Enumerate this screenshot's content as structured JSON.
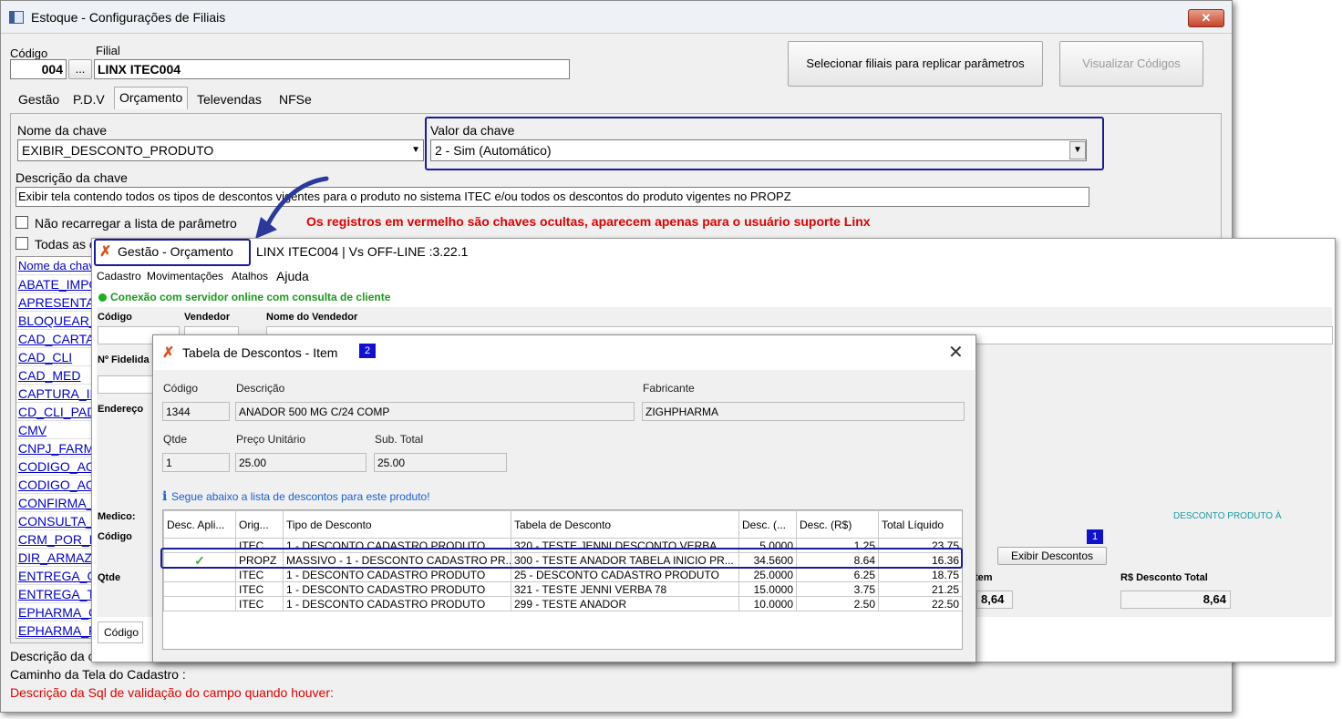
{
  "window": {
    "title": "Estoque - Configurações de Filiais",
    "close": "✕"
  },
  "header": {
    "codigo_label": "Código",
    "codigo_value": "004",
    "dots": "...",
    "filial_label": "Filial",
    "filial_value": "LINX ITEC004",
    "replicar_button": "Selecionar filiais para replicar parâmetros",
    "visualizar_button": "Visualizar Códigos"
  },
  "tabs": [
    "Gestão",
    "P.D.V",
    "Orçamento",
    "Televendas",
    "NFSe"
  ],
  "key": {
    "name_label": "Nome da chave",
    "name_value": "EXIBIR_DESCONTO_PRODUTO",
    "value_label": "Valor da chave",
    "value_value": "2 - Sim (Automático)",
    "desc_label": "Descrição da chave",
    "desc_value": "Exibir tela contendo todos os tipos de descontos vigentes para o produto no sistema ITEC e/ou todos os descontos do produto vigentes no PROPZ",
    "nao_recarregar": "Não recarregar a lista de parâmetro",
    "todas": "Todas as c",
    "hidden_note": "Os registros em vermelho são chaves ocultas, aparecem apenas para o usuário suporte Linx"
  },
  "key_list": {
    "header": "Nome da chav",
    "items": [
      "ABATE_IMPO",
      "APRESENTA",
      "BLOQUEAR_",
      "CAD_CARTA",
      "CAD_CLI",
      "CAD_MED",
      "CAPTURA_IM",
      "CD_CLI_PAD",
      "CMV",
      "CNPJ_FARMA",
      "CODIGO_ACE",
      "CODIGO_ACE",
      "CONFIRMA_M",
      "CONSULTA_P",
      "CRM_POR_P",
      "DIR_ARMAZE",
      "ENTREGA_G",
      "ENTREGA_T",
      "EPHARMA_C",
      "EPHARMA_F"
    ]
  },
  "footer": {
    "desc": "Descrição da ch",
    "caminho": "Caminho da Tela do Cadastro :",
    "sql": "Descrição da Sql de validação do campo quando houver:"
  },
  "orcamento": {
    "title": "Gestão - Orçamento",
    "subtitle": "LINX ITEC004 | Vs OFF-LINE :3.22.1",
    "menu": [
      "Cadastro",
      "Movimentações",
      "Atalhos",
      "Ajuda"
    ],
    "status": "Conexão com servidor online com consulta de cliente",
    "codigo": "Código",
    "vendedor": "Vendedor",
    "nome_vendedor": "Nome do Vendedor",
    "fidelidade": "Nº Fidelida",
    "endereco": "Endereço",
    "medico": "Medico:",
    "codigo2": "Código",
    "qtde": "Qtde",
    "codigo_tab": "Código",
    "desconto_produto": "DESCONTO PRODUTO À",
    "badge1": "1",
    "exibir_descontos": "Exibir Descontos",
    "item_label": "tem",
    "item_value": "8,64",
    "rs_desconto_label": "R$ Desconto Total",
    "rs_desconto_value": "8,64"
  },
  "dialog": {
    "title": "Tabela de Descontos - Item",
    "badge": "2",
    "codigo_label": "Código",
    "codigo": "1344",
    "descricao_label": "Descrição",
    "descricao": "ANADOR 500 MG C/24 COMP",
    "fabricante_label": "Fabricante",
    "fabricante": "ZIGHPHARMA",
    "qtde_label": "Qtde",
    "qtde": "1",
    "preco_label": "Preço Unitário",
    "preco": "25.00",
    "subtotal_label": "Sub. Total",
    "subtotal": "25.00",
    "info": "Segue abaixo a lista de descontos para este produto!",
    "columns": [
      "Desc. Apli...",
      "Orig...",
      "Tipo de Desconto",
      "Tabela de Desconto",
      "Desc. (...",
      "Desc. (R$)",
      "Total Líquido"
    ],
    "rows": [
      [
        "",
        "ITEC",
        "1 - DESCONTO CADASTRO PRODUTO",
        "320 - TESTE JENNI DESCONTO VERBA",
        "5.0000",
        "1.25",
        "23.75"
      ],
      [
        "✓",
        "PROPZ",
        "MASSIVO - 1 - DESCONTO CADASTRO PR...",
        "300 - TESTE ANADOR TABELA INICIO PR...",
        "34.5600",
        "8.64",
        "16.36"
      ],
      [
        "",
        "ITEC",
        "1 - DESCONTO CADASTRO PRODUTO",
        "25 - DESCONTO CADASTRO PRODUTO",
        "25.0000",
        "6.25",
        "18.75"
      ],
      [
        "",
        "ITEC",
        "1 - DESCONTO CADASTRO PRODUTO",
        "321 - TESTE JENNI VERBA 78",
        "15.0000",
        "3.75",
        "21.25"
      ],
      [
        "",
        "ITEC",
        "1 - DESCONTO CADASTRO PRODUTO",
        "299 - TESTE ANADOR",
        "10.0000",
        "2.50",
        "22.50"
      ]
    ]
  }
}
